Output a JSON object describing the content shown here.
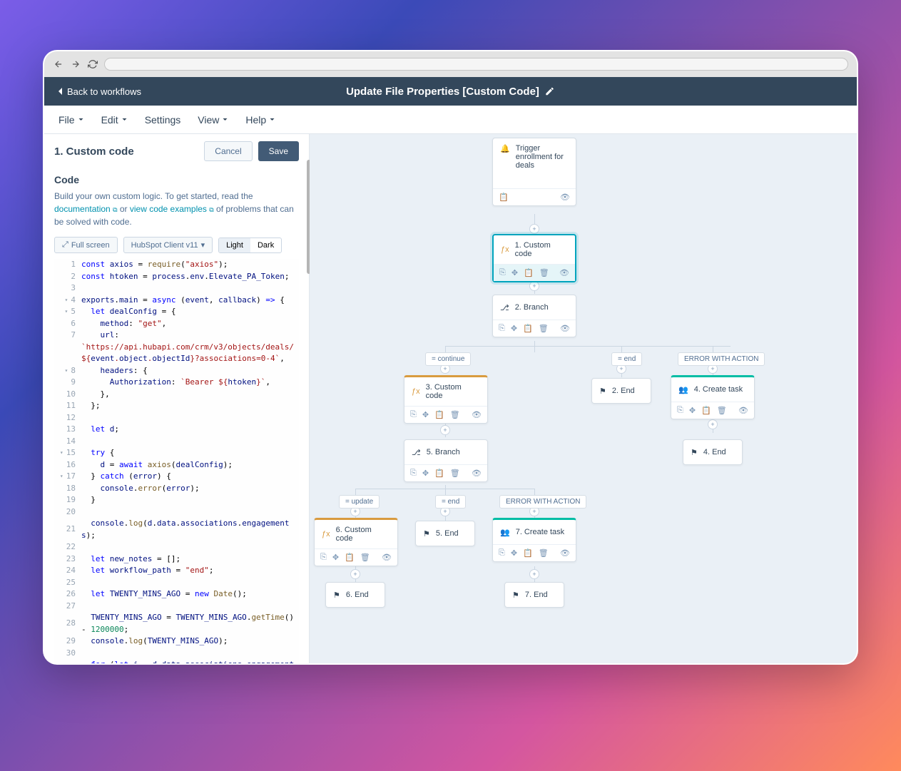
{
  "header": {
    "back": "Back to workflows",
    "title": "Update File Properties [Custom Code]"
  },
  "menu": [
    "File",
    "Edit",
    "Settings",
    "View",
    "Help"
  ],
  "sidebar": {
    "title": "1. Custom code",
    "cancel": "Cancel",
    "save": "Save",
    "code_label": "Code",
    "desc_pre": "Build your own custom logic. To get started, read the ",
    "link_docs": "documentation",
    "desc_or": " or ",
    "link_examples": "view code examples",
    "desc_post": " of problems that can be solved with code.",
    "fullscreen": "Full screen",
    "client": "HubSpot Client v11",
    "theme_light": "Light",
    "theme_dark": "Dark"
  },
  "nodes": {
    "trigger": "Trigger enrollment for deals",
    "n1": "1. Custom code",
    "n2": "2. Branch",
    "n3": "3. Custom code",
    "n4_end": "2. End",
    "n4_task": "4. Create task",
    "n4_end2": "4. End",
    "n5": "5. Branch",
    "n5_end": "5. End",
    "n6": "6. Custom code",
    "n6_end": "6. End",
    "n7": "7. Create task",
    "n7_end": "7. End"
  },
  "branches": {
    "continue": "= continue",
    "end": "= end",
    "error": "ERROR WITH ACTION",
    "update": "= update"
  }
}
